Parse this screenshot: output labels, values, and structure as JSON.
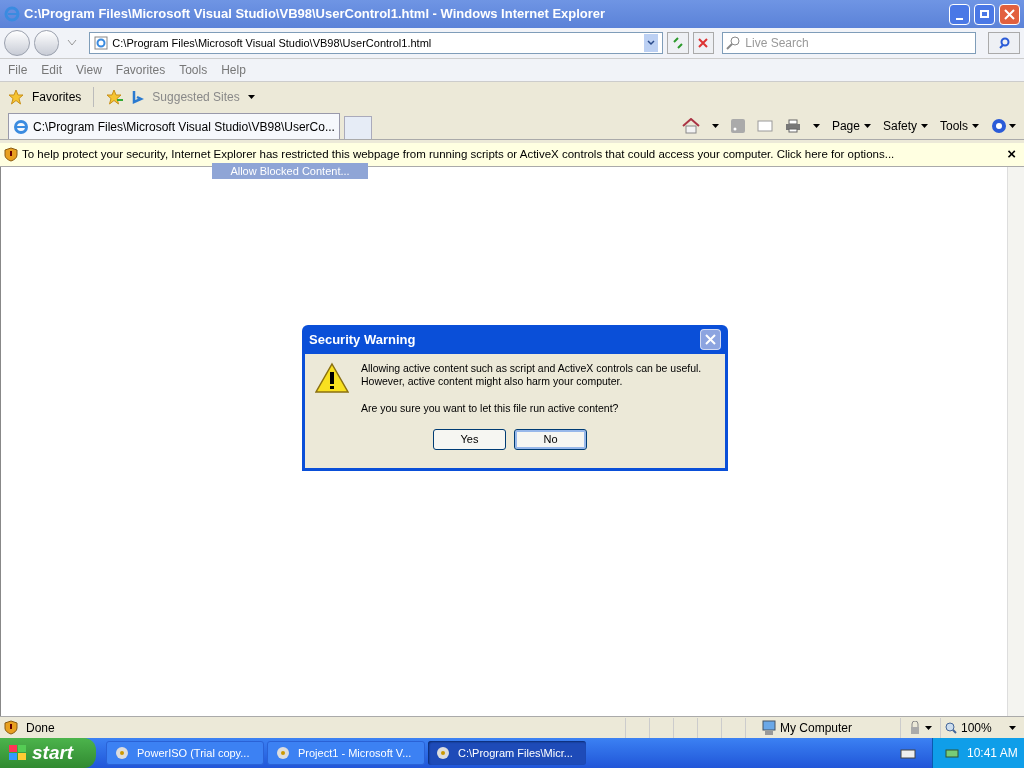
{
  "window": {
    "title": "C:\\Program Files\\Microsoft Visual Studio\\VB98\\UserControl1.html - Windows Internet Explorer"
  },
  "address_bar": {
    "value": "C:\\Program Files\\Microsoft Visual Studio\\VB98\\UserControl1.html"
  },
  "search": {
    "placeholder": "Live Search"
  },
  "menu": [
    "File",
    "Edit",
    "View",
    "Favorites",
    "Tools",
    "Help"
  ],
  "favorites_bar": {
    "favorites": "Favorites",
    "suggested_sites": "Suggested Sites"
  },
  "tabs": [
    {
      "label": "C:\\Program Files\\Microsoft Visual Studio\\VB98\\UserCo...",
      "selected": true
    }
  ],
  "command_bar": [
    "Page",
    "Safety",
    "Tools"
  ],
  "info_bar": {
    "message": "To help protect your security, Internet Explorer has restricted this webpage from running scripts or ActiveX controls that could access your computer. Click here for options...",
    "close": "×",
    "menu_item": "Allow Blocked Content..."
  },
  "dialog": {
    "title": "Security Warning",
    "message": "Allowing active content such as script and ActiveX controls can be useful. However, active content might also harm your computer.",
    "question": "Are you sure you want to let this file run active content?",
    "buttons": [
      {
        "label": "Yes",
        "selected": false
      },
      {
        "label": "No",
        "selected": true
      }
    ]
  },
  "status_bar": {
    "status": "Done",
    "zone": "My Computer",
    "zoom": "100%"
  },
  "taskbar": {
    "start": "start",
    "items": [
      {
        "label": "PowerISO (Trial copy...",
        "selected": false
      },
      {
        "label": "Project1 - Microsoft V...",
        "selected": false
      },
      {
        "label": "C:\\Program Files\\Micr...",
        "selected": true
      }
    ],
    "clock": "10:41 AM"
  }
}
